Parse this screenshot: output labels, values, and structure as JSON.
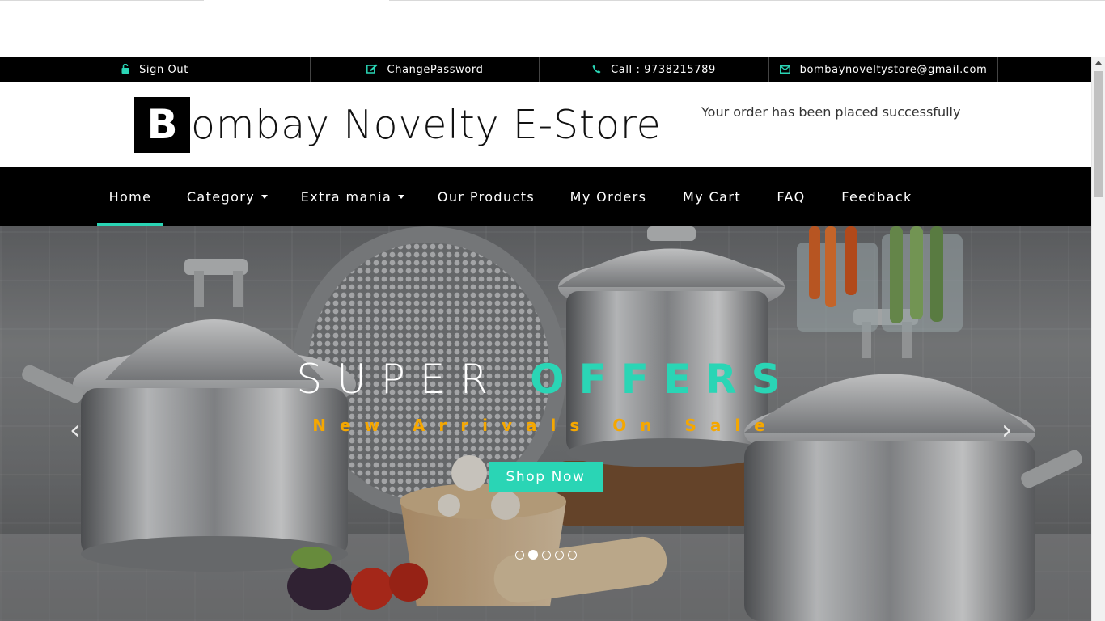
{
  "topbar": {
    "sign_out": "Sign Out",
    "change_password": "ChangePassword",
    "call": "Call : 9738215789",
    "email": "bombaynoveltystore@gmail.com"
  },
  "header": {
    "logo_initial": "B",
    "logo_rest": "ombay Novelty E-Store",
    "order_message": "Your order has been placed successfully"
  },
  "nav": {
    "items": [
      {
        "label": "Home",
        "active": true
      },
      {
        "label": "Category",
        "dropdown": true
      },
      {
        "label": "Extra mania",
        "dropdown": true
      },
      {
        "label": "Our Products"
      },
      {
        "label": "My Orders"
      },
      {
        "label": "My Cart"
      },
      {
        "label": "FAQ"
      },
      {
        "label": "Feedback"
      }
    ]
  },
  "hero": {
    "title_plain": "SUPER",
    "title_accent": "OFFERS",
    "subtitle": "New Arrivals On Sale",
    "button": "Shop Now",
    "prev_icon": "‹",
    "next_icon": "›",
    "slide_count": 5,
    "active_slide": 2
  },
  "colors": {
    "accent": "#2ad5b5",
    "subtitle": "#f5a700",
    "bar": "#000000"
  }
}
